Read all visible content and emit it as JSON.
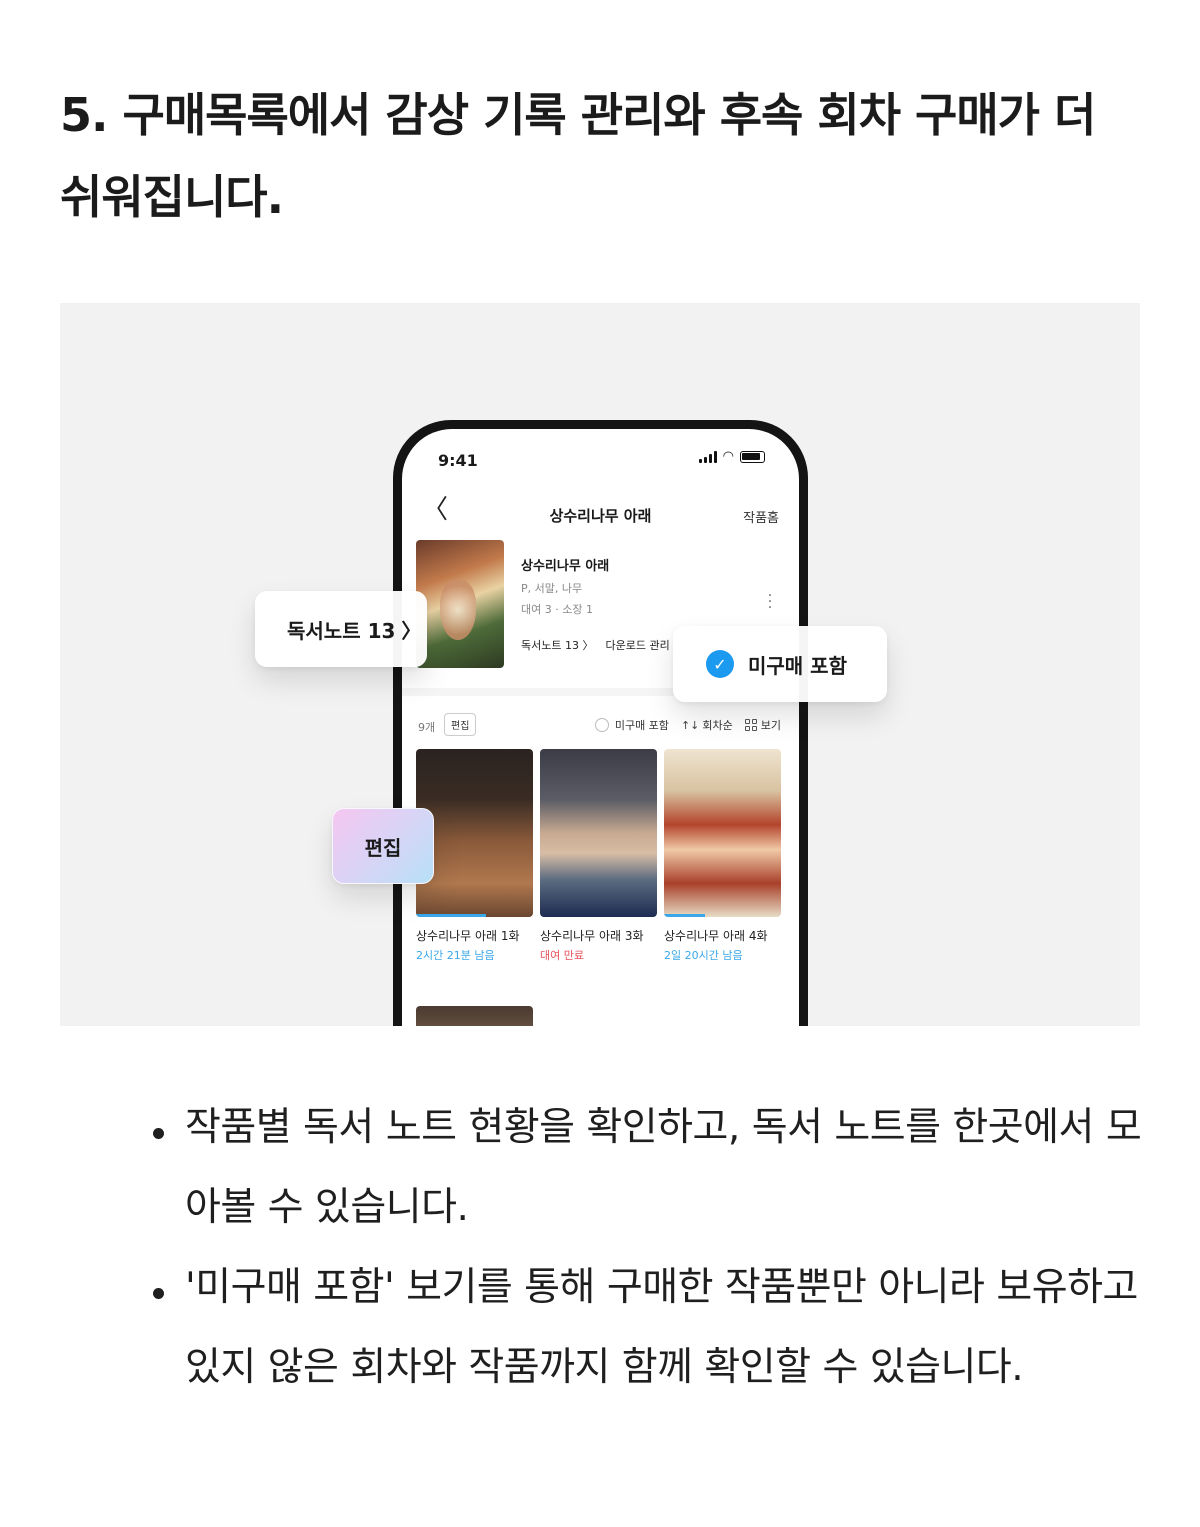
{
  "heading": "5. 구매목록에서 감상 기록 관리와 후속 회차 구매가 더 쉬워집니다.",
  "phone": {
    "status_time": "9:41",
    "nav": {
      "back": "〈",
      "title": "상수리나무 아래",
      "home": "작품홈"
    },
    "work": {
      "title": "상수리나무 아래",
      "authors": "P, 서말, 나무",
      "ownership": "대여 3 · 소장 1",
      "notes_link": "독서노트 13 〉",
      "download_link": "다운로드 관리"
    },
    "toolbar": {
      "count": "9개",
      "edit": "편집",
      "unpaid": "미구매 포함",
      "sort": "회차순",
      "view": "보기"
    },
    "episodes": [
      {
        "title": "상수리나무 아래 1화",
        "status": "2시간 21분 남음",
        "status_color": "#39a7e8",
        "progress": 0.6
      },
      {
        "title": "상수리나무 아래 3화",
        "status": "대여 만료",
        "status_color": "#e8505b",
        "progress": 0
      },
      {
        "title": "상수리나무 아래 4화",
        "status": "2일 20시간 남음",
        "status_color": "#39a7e8",
        "progress": 0.35
      }
    ]
  },
  "callouts": {
    "notes": "독서노트 13",
    "notes_arrow": "〉",
    "unpaid": "미구매 포함",
    "edit": "편집"
  },
  "bullets": [
    "작품별 독서 노트 현황을 확인하고, 독서 노트를 한곳에서 모아볼 수 있습니다.",
    "'미구매 포함' 보기를 통해 구매한 작품뿐만 아니라 보유하고 있지 않은 회차와 작품까지 함께 확인할 수 있습니다."
  ]
}
